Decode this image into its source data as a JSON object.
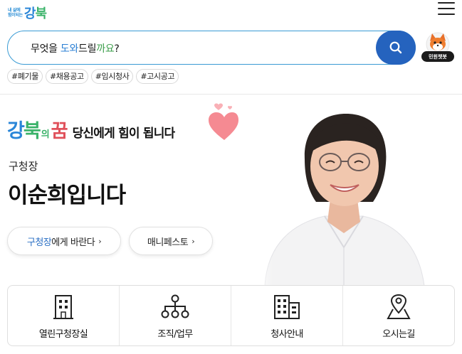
{
  "header": {
    "logo_small_line1": "내 삶에",
    "logo_small_line2": "힘이되는",
    "logo_part1": "강",
    "logo_part2": "북",
    "menu_icon": "hamburger-icon"
  },
  "search": {
    "text_part1": "무엇을 ",
    "text_hl1": "도와",
    "text_part2": "드릴",
    "text_hl2": "까요",
    "text_part3": "?",
    "button_icon": "search-icon",
    "chatbot_label": "민원챗봇",
    "colors": {
      "border": "#3a9bd4",
      "button": "#2563be"
    }
  },
  "tags": [
    "#폐기물",
    "#채용공고",
    "#임시청사",
    "#고시공고"
  ],
  "hero": {
    "slogan_part1": "강",
    "slogan_part2": "북",
    "slogan_connector": "의",
    "slogan_dream": "꿈",
    "slogan_tail": "당신에게 힘이 됩니다",
    "role": "구청장",
    "name": "이순희입니다",
    "button_a_hl": "구청장",
    "button_a_rest": "에게 바란다",
    "button_b": "매니페스토",
    "arrow": "›"
  },
  "quick_menu": [
    {
      "label": "열린구청장실",
      "icon": "building-icon"
    },
    {
      "label": "조직/업무",
      "icon": "org-chart-icon"
    },
    {
      "label": "청사안내",
      "icon": "office-building-icon"
    },
    {
      "label": "오시는길",
      "icon": "map-pin-icon"
    }
  ]
}
